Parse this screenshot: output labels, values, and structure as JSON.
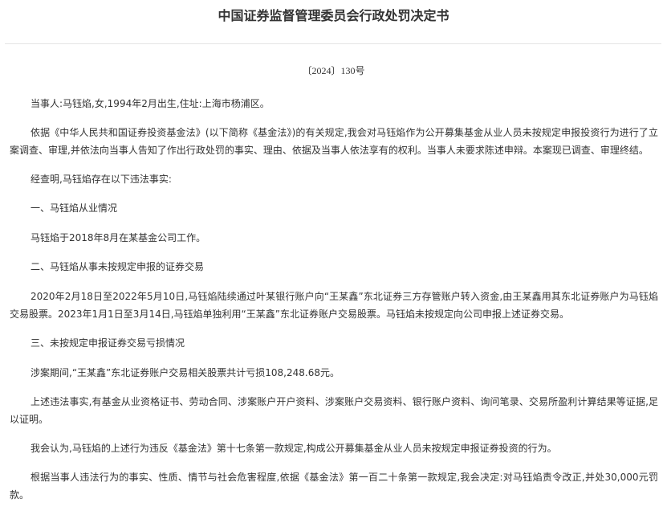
{
  "document": {
    "title": "中国证券监督管理委员会行政处罚决定书",
    "doc_number": "〔2024〕130号",
    "paragraphs": [
      "当事人:马钰焰,女,1994年2月出生,住址:上海市杨浦区。",
      "依据《中华人民共和国证券投资基金法》(以下简称《基金法》)的有关规定,我会对马钰焰作为公开募集基金从业人员未按规定申报投资行为进行了立案调查、审理,并依法向当事人告知了作出行政处罚的事实、理由、依据及当事人依法享有的权利。当事人未要求陈述申辩。本案现已调查、审理终结。",
      "经查明,马钰焰存在以下违法事实:",
      "一、马钰焰从业情况",
      "马钰焰于2018年8月在某基金公司工作。",
      "二、马钰焰从事未按规定申报的证券交易",
      "2020年2月18日至2022年5月10日,马钰焰陆续通过叶某银行账户向“王某鑫”东北证券三方存管账户转入资金,由王某鑫用其东北证券账户为马钰焰交易股票。2023年1月1日至3月14日,马钰焰单独利用“王某鑫”东北证券账户交易股票。马钰焰未按规定向公司申报上述证券交易。",
      "三、未按规定申报证券交易亏损情况",
      "涉案期间,“王某鑫”东北证券账户交易相关股票共计亏损108,248.68元。",
      "上述违法事实,有基金从业资格证书、劳动合同、涉案账户开户资料、涉案账户交易资料、银行账户资料、询问笔录、交易所盈利计算结果等证据,足以证明。",
      "我会认为,马钰焰的上述行为违反《基金法》第十七条第一款规定,构成公开募集基金从业人员未按规定申报证券投资的行为。",
      "根据当事人违法行为的事实、性质、情节与社会危害程度,依据《基金法》第一百二十条第一款规定,我会决定:对马钰焰责令改正,并处30,000元罚款。"
    ]
  }
}
